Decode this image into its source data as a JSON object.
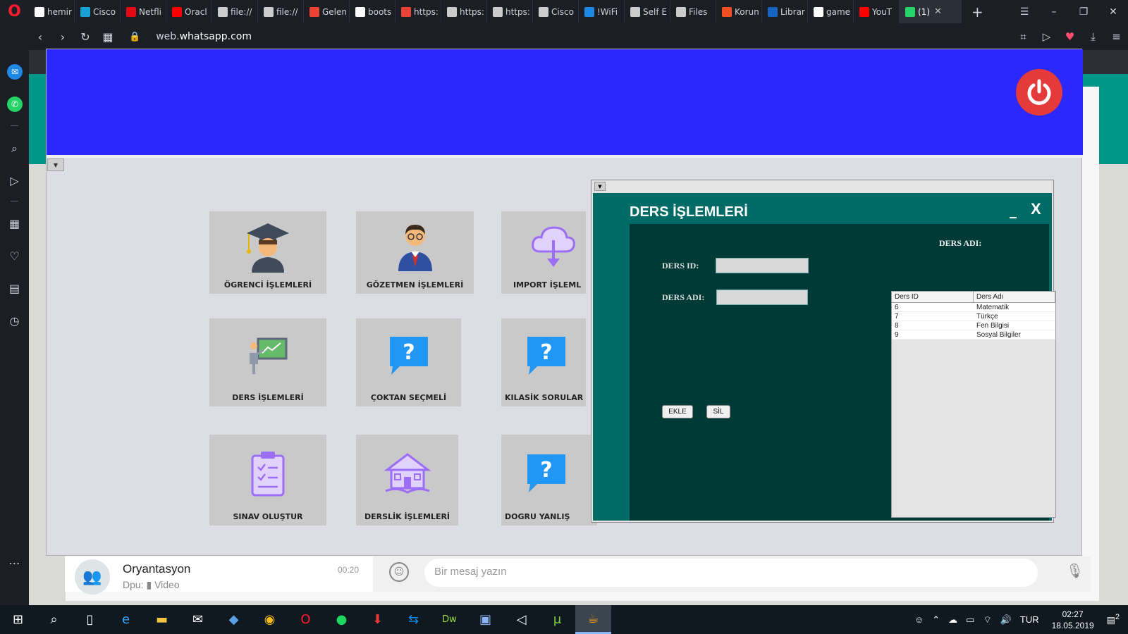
{
  "browser": {
    "tabs": [
      {
        "label": "hemir",
        "icon": "google-icon",
        "color": "#ffffff"
      },
      {
        "label": "Cisco",
        "icon": "cisco-icon",
        "color": "#1ba0d7"
      },
      {
        "label": "Netfli",
        "icon": "netflix-icon",
        "color": "#e50914"
      },
      {
        "label": "Oracl",
        "icon": "oracle-icon",
        "color": "#f80000"
      },
      {
        "label": "file://",
        "icon": "file-icon",
        "color": "#cccccc"
      },
      {
        "label": "file://",
        "icon": "file-icon",
        "color": "#cccccc"
      },
      {
        "label": "Gelen",
        "icon": "gmail-icon",
        "color": "#ea4335"
      },
      {
        "label": "boots",
        "icon": "google-icon",
        "color": "#ffffff"
      },
      {
        "label": "https:",
        "icon": "gmail-icon",
        "color": "#ea4335"
      },
      {
        "label": "https:",
        "icon": "network-icon",
        "color": "#cccccc"
      },
      {
        "label": "https:",
        "icon": "network-icon",
        "color": "#cccccc"
      },
      {
        "label": "Cisco",
        "icon": "network-icon",
        "color": "#cccccc"
      },
      {
        "label": "!WiFi",
        "icon": "wifi-icon",
        "color": "#1e88e5"
      },
      {
        "label": "Self E",
        "icon": "network-icon",
        "color": "#cccccc"
      },
      {
        "label": "Files",
        "icon": "network-icon",
        "color": "#cccccc"
      },
      {
        "label": "Korun",
        "icon": "microsoft-icon",
        "color": "#f25022"
      },
      {
        "label": "Librar",
        "icon": "library-icon",
        "color": "#1565c0"
      },
      {
        "label": "game",
        "icon": "google-icon",
        "color": "#ffffff"
      },
      {
        "label": "YouT",
        "icon": "youtube-icon",
        "color": "#ff0000"
      },
      {
        "label": "(1)",
        "icon": "whatsapp-icon",
        "color": "#25d366",
        "active": true
      }
    ],
    "url_prefix": "web.",
    "url_domain": "whatsapp.com"
  },
  "app": {
    "header_color": "#2b28fb",
    "tiles": [
      {
        "label": "ÖGRENCİ İŞLEMLERİ",
        "icon": "student-graduate-icon"
      },
      {
        "label": "GÖZETMEN İŞLEMLERİ",
        "icon": "supervisor-icon"
      },
      {
        "label": "IMPORT İŞLEML",
        "icon": "cloud-import-icon"
      },
      {
        "label": "DERS İŞLEMLERİ",
        "icon": "teacher-board-icon"
      },
      {
        "label": "ÇOKTAN SEÇMELİ",
        "icon": "question-bubble-icon"
      },
      {
        "label": "KILASİK SORULAR",
        "icon": "question-bubble-icon"
      },
      {
        "label": "SINAV OLUŞTUR",
        "icon": "clipboard-check-icon"
      },
      {
        "label": "DERSLİK İŞLEMLERİ",
        "icon": "school-building-icon"
      },
      {
        "label": "DOGRU YANLIŞ",
        "icon": "question-bubble-icon"
      }
    ]
  },
  "dialog": {
    "title": "DERS İŞLEMLERİ",
    "minimize": "_",
    "close": "X",
    "ders_id_label": "DERS ID:",
    "ders_adi_label": "DERS ADI:",
    "ders_adi_header": "DERS ADI:",
    "ders_id_value": "",
    "ders_adi_value": "",
    "add_label": "EKLE",
    "delete_label": "SİL",
    "table": {
      "headers": [
        "Ders ID",
        "Ders Adı"
      ],
      "rows": [
        [
          "6",
          "Matematik"
        ],
        [
          "7",
          "Türkçe"
        ],
        [
          "8",
          "Fen Bilgisi"
        ],
        [
          "9",
          "Sosyal Bilgiler"
        ]
      ]
    }
  },
  "whatsapp": {
    "chat_name": "Oryantasyon",
    "chat_time": "00:20",
    "chat_sender": "Dpu:",
    "chat_preview": "Video",
    "message_placeholder": "Bir mesaj yazın"
  },
  "taskbar": {
    "language": "TUR",
    "time": "02:27",
    "date": "18.05.2019",
    "notification_count": "2"
  }
}
